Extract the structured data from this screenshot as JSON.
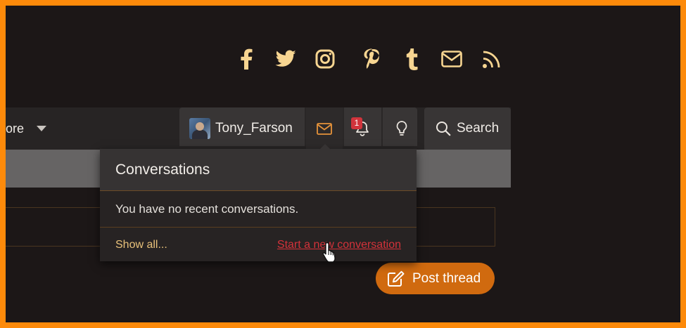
{
  "social": [
    "facebook-icon",
    "twitter-icon",
    "instagram-icon",
    "pinterest-icon",
    "tumblr-icon",
    "mail-icon",
    "rss-icon"
  ],
  "nav": {
    "more_label": "ore"
  },
  "user": {
    "name": "Tony_Farson"
  },
  "alerts": {
    "badge_count": "1"
  },
  "search": {
    "label": "Search"
  },
  "conversations": {
    "title": "Conversations",
    "empty_text": "You have no recent conversations.",
    "show_all": "Show all...",
    "start_new": "Start a new conversation"
  },
  "actions": {
    "post_thread": "Post thread"
  },
  "colors": {
    "accent": "#d06a0f",
    "icon": "#f7d591",
    "frame": "#fd8a0a",
    "link_red": "#d4323a"
  }
}
